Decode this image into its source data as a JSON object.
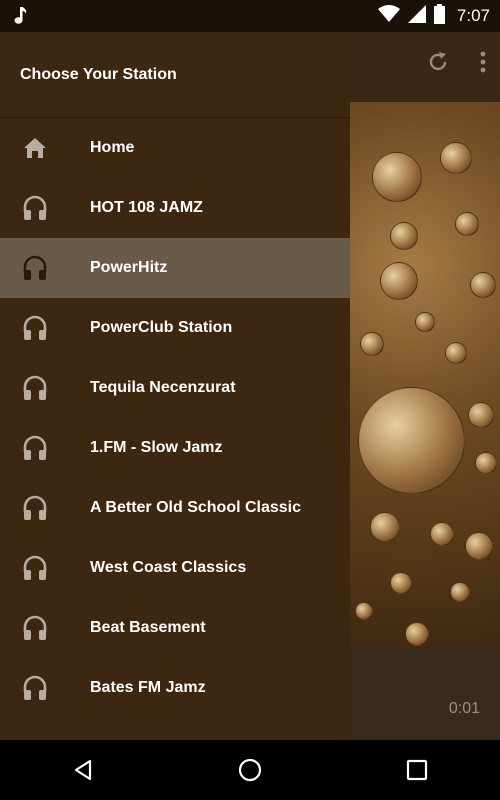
{
  "status_bar": {
    "time": "7:07",
    "icons": [
      "music-note-icon",
      "wifi-icon",
      "signal-icon",
      "battery-icon"
    ]
  },
  "drawer": {
    "title": "Choose Your Station",
    "items": [
      {
        "label": "Home",
        "icon": "home-icon",
        "active": false
      },
      {
        "label": "HOT 108 JAMZ",
        "icon": "headphones-icon",
        "active": false
      },
      {
        "label": "PowerHitz",
        "icon": "headphones-icon",
        "active": true
      },
      {
        "label": "PowerClub Station",
        "icon": "headphones-icon",
        "active": false
      },
      {
        "label": "Tequila Necenzurat",
        "icon": "headphones-icon",
        "active": false
      },
      {
        "label": "1.FM - Slow Jamz",
        "icon": "headphones-icon",
        "active": false
      },
      {
        "label": "A Better Old School Classic",
        "icon": "headphones-icon",
        "active": false
      },
      {
        "label": "West Coast Classics",
        "icon": "headphones-icon",
        "active": false
      },
      {
        "label": "Beat Basement",
        "icon": "headphones-icon",
        "active": false
      },
      {
        "label": "Bates FM Jamz",
        "icon": "headphones-icon",
        "active": false
      }
    ]
  },
  "app": {
    "toolbar_icons": [
      "refresh-icon",
      "overflow-menu-icon"
    ],
    "elapsed_time": "0:01"
  },
  "nav_bar": {
    "buttons": [
      "back-icon",
      "home-circle-icon",
      "recents-icon"
    ]
  },
  "colors": {
    "drawer_bg": "#3e2710",
    "active_item_bg": "#6a5a4a",
    "text": "#ffffff"
  }
}
